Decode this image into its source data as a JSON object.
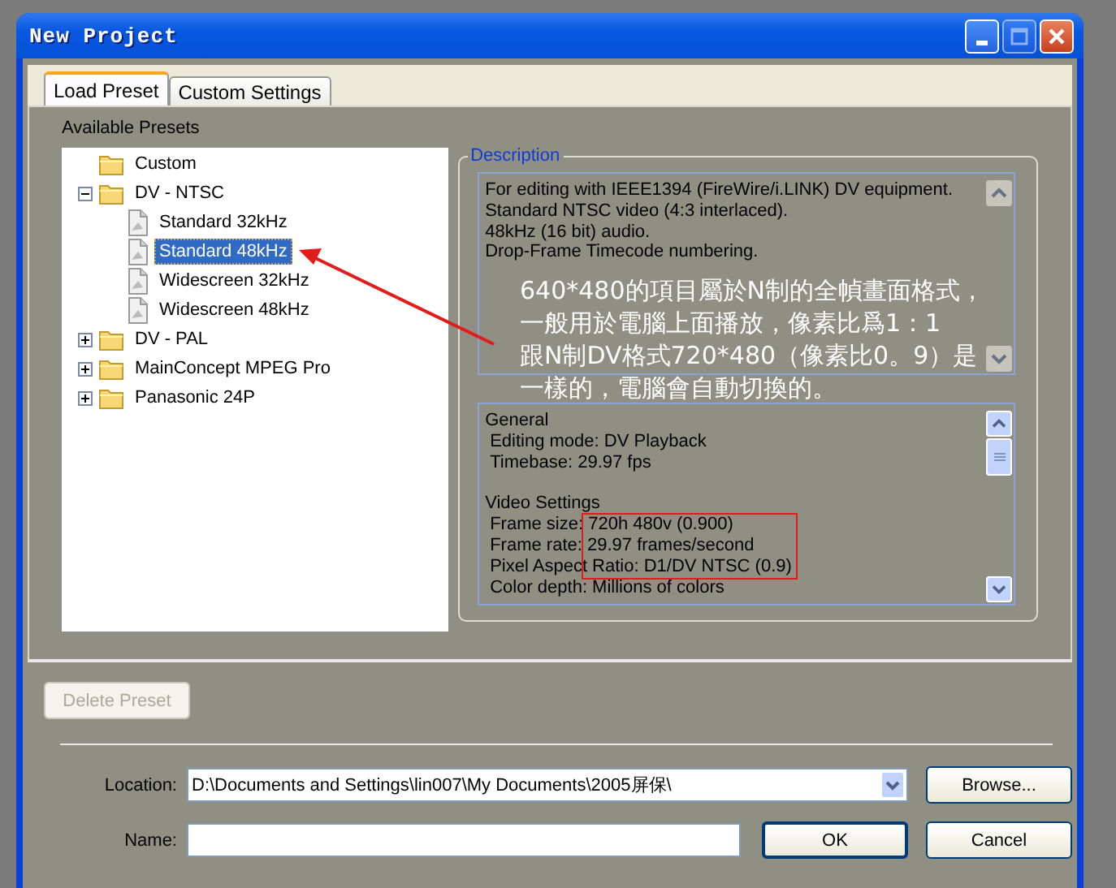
{
  "window": {
    "title": "New Project"
  },
  "tabs": [
    {
      "label": "Load Preset",
      "selected": true
    },
    {
      "label": "Custom Settings",
      "selected": false
    }
  ],
  "presets": {
    "label": "Available Presets",
    "items": [
      {
        "label": "Custom",
        "kind": "folder",
        "selected": false
      },
      {
        "label": "DV - NTSC",
        "kind": "folder",
        "expanded": true,
        "selected": false,
        "children": [
          {
            "label": "Standard 32kHz",
            "kind": "preset",
            "selected": false
          },
          {
            "label": "Standard 48kHz",
            "kind": "preset",
            "selected": true
          },
          {
            "label": "Widescreen 32kHz",
            "kind": "preset",
            "selected": false
          },
          {
            "label": "Widescreen 48kHz",
            "kind": "preset",
            "selected": false
          }
        ]
      },
      {
        "label": "DV - PAL",
        "kind": "folder",
        "expanded": false,
        "selected": false
      },
      {
        "label": "MainConcept MPEG Pro",
        "kind": "folder",
        "expanded": false,
        "selected": false
      },
      {
        "label": "Panasonic 24P",
        "kind": "folder",
        "expanded": false,
        "selected": false
      }
    ]
  },
  "description": {
    "title": "Description",
    "text": [
      "For editing with IEEE1394 (FireWire/i.LINK) DV equipment.",
      "Standard NTSC video (4:3 interlaced).",
      "48kHz (16 bit) audio.",
      "Drop-Frame Timecode numbering."
    ],
    "summary": [
      {
        "kind": "heading",
        "text": "General"
      },
      {
        "kind": "item",
        "text": "Editing mode: DV Playback"
      },
      {
        "kind": "item",
        "text": "Timebase: 29.97 fps"
      },
      {
        "kind": "heading",
        "text": "Video Settings"
      },
      {
        "kind": "item",
        "text": "Frame size: 720h 480v (0.900)"
      },
      {
        "kind": "item",
        "text": "Frame rate: 29.97 frames/second"
      },
      {
        "kind": "item",
        "text": "Pixel Aspect Ratio: D1/DV NTSC (0.9)"
      },
      {
        "kind": "item",
        "text": "Color depth: Millions of colors"
      }
    ]
  },
  "delete_button": {
    "label": "Delete Preset",
    "disabled": true
  },
  "location": {
    "label": "Location:",
    "value": "D:\\Documents and Settings\\lin007\\My Documents\\2005屏保\\"
  },
  "name": {
    "label": "Name:"
  },
  "buttons": [
    "Browse...",
    "OK",
    "Cancel"
  ],
  "annotation": {
    "note": [
      "640*480的項目屬於N制的全幀畫面格式，",
      "一般用於電腦上面播放，像素比爲1：1",
      "跟N制DV格式720*480（像素比0。9）是",
      "一樣的，電腦會自動切換的。"
    ]
  }
}
